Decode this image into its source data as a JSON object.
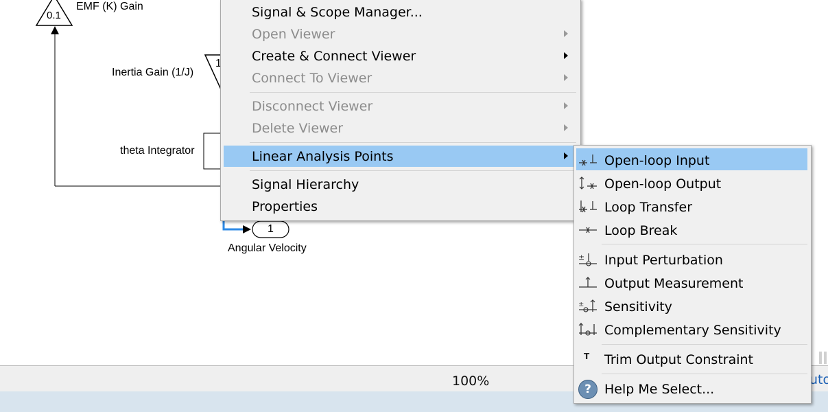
{
  "diagram": {
    "emf_gain": {
      "value": "0.1",
      "label": "EMF (K) Gain"
    },
    "inertia_gain": {
      "value": "1",
      "label": "Inertia Gain (1/J)"
    },
    "theta_integrator": {
      "label": "theta Integrator"
    },
    "outport": {
      "number": "1",
      "label": "Angular Velocity"
    }
  },
  "context_menu": {
    "items": [
      {
        "label": "Signal & Scope Manager...",
        "enabled": true,
        "submenu": false
      },
      {
        "label": "Open Viewer",
        "enabled": false,
        "submenu": true
      },
      {
        "label": "Create & Connect Viewer",
        "enabled": true,
        "submenu": true
      },
      {
        "label": "Connect To Viewer",
        "enabled": false,
        "submenu": true
      },
      {
        "label": "Disconnect Viewer",
        "enabled": false,
        "submenu": true
      },
      {
        "label": "Delete Viewer",
        "enabled": false,
        "submenu": true
      },
      {
        "label": "Linear Analysis Points",
        "enabled": true,
        "submenu": true,
        "highlighted": true
      },
      {
        "label": "Signal Hierarchy",
        "enabled": true,
        "submenu": false
      },
      {
        "label": "Properties",
        "enabled": true,
        "submenu": false
      }
    ]
  },
  "submenu": {
    "items": [
      {
        "label": "Open-loop Input",
        "icon": "open-loop-input-icon",
        "highlighted": true
      },
      {
        "label": "Open-loop Output",
        "icon": "open-loop-output-icon"
      },
      {
        "label": "Loop Transfer",
        "icon": "loop-transfer-icon"
      },
      {
        "label": "Loop Break",
        "icon": "loop-break-icon"
      },
      {
        "label": "Input Perturbation",
        "icon": "input-perturbation-icon"
      },
      {
        "label": "Output Measurement",
        "icon": "output-measurement-icon"
      },
      {
        "label": "Sensitivity",
        "icon": "sensitivity-icon"
      },
      {
        "label": "Complementary Sensitivity",
        "icon": "complementary-sensitivity-icon"
      },
      {
        "label": "Trim Output Constraint",
        "icon": "trim-output-constraint-icon",
        "glyph": "T"
      },
      {
        "label": "Help Me Select...",
        "icon": "help-icon",
        "glyph": "?"
      }
    ]
  },
  "statusbar": {
    "zoom": "100%",
    "solver_partial": "uto"
  },
  "colors": {
    "highlight": "#99c9f3",
    "signal_selected": "#2e8ae6",
    "menu_bg": "#f0f0f0"
  }
}
